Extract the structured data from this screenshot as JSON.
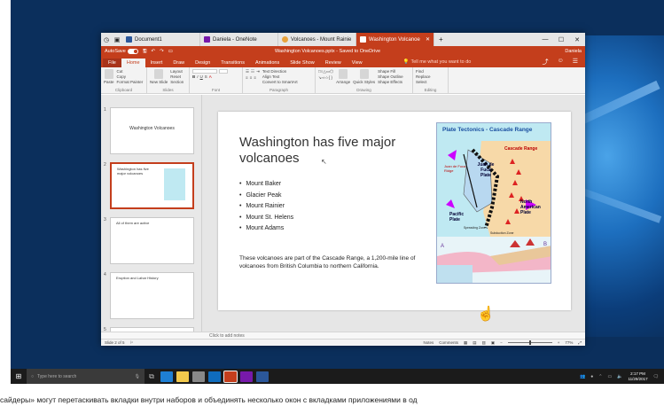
{
  "browser_tabs": [
    {
      "label": "Document1",
      "color": "#2b579a"
    },
    {
      "label": "Daniela - OneNote",
      "color": "#7719aa"
    },
    {
      "label": "Volcanoes - Mount Rainie",
      "color": "#c43e1c"
    },
    {
      "label": "Washington Volcanoe",
      "color": "#c43e1c",
      "active": true
    }
  ],
  "titlebar": {
    "autosave_label": "AutoSave",
    "autosave_state": "On",
    "doc_title": "Washington Volcanoes.pptx - Saved to OneDrive",
    "user": "Daniela"
  },
  "ribbon_tabs": [
    "File",
    "Home",
    "Insert",
    "Draw",
    "Design",
    "Transitions",
    "Animations",
    "Slide Show",
    "Review",
    "View"
  ],
  "active_ribbon_tab": "Home",
  "tell_me": "Tell me what you want to do",
  "ribbon_groups": {
    "clipboard": {
      "label": "Clipboard",
      "paste": "Paste",
      "cut": "Cut",
      "copy": "Copy",
      "format_painter": "Format Painter"
    },
    "slides": {
      "label": "Slides",
      "new_slide": "New Slide",
      "layout": "Layout",
      "reset": "Reset",
      "section": "Section"
    },
    "font": {
      "label": "Font"
    },
    "paragraph": {
      "label": "Paragraph",
      "text_direction": "Text Direction",
      "align_text": "Align Text",
      "convert": "Convert to SmartArt"
    },
    "drawing": {
      "label": "Drawing",
      "arrange": "Arrange",
      "quick_styles": "Quick Styles",
      "shape_fill": "Shape Fill",
      "shape_outline": "Shape Outline",
      "shape_effects": "Shape Effects"
    },
    "editing": {
      "label": "Editing",
      "find": "Find",
      "replace": "Replace",
      "select": "Select"
    }
  },
  "thumbnails": [
    {
      "num": "1",
      "title": "Washington Volcanoes"
    },
    {
      "num": "2",
      "title": "Washington has five major volcanoes"
    },
    {
      "num": "3",
      "title": "All of them are active"
    },
    {
      "num": "4",
      "title": "Eruption and Lahar History"
    },
    {
      "num": "5",
      "title": ""
    }
  ],
  "slide": {
    "title": "Washington has five major volcanoes",
    "bullets": [
      "Mount Baker",
      "Glacier Peak",
      "Mount Rainier",
      "Mount St. Helens",
      "Mount Adams"
    ],
    "paragraph": "These volcanoes are part of the Cascade Range, a 1,200-mile line of volcanoes from British Columbia to northern California.",
    "map": {
      "title": "Plate Tectonics - Cascade Range",
      "labels": [
        "Cascade Range",
        "Juan de Fuca Plate",
        "Juan de Fuca Ridge",
        "Pacific Plate",
        "North American Plate",
        "Spreading Zone",
        "Subduction Zone",
        "A",
        "B"
      ]
    }
  },
  "notes_placeholder": "Click to add notes",
  "status": {
    "slide_info": "Slide 2 of 5",
    "notes": "Notes",
    "comments": "Comments",
    "zoom": "77%"
  },
  "taskbar": {
    "search_placeholder": "Type here to search",
    "time": "2:17 PM",
    "date": "11/29/2017"
  },
  "caption": "сайдеры» могут перетаскивать вкладки внутри наборов и объединять несколько окон с вкладками приложениями в од"
}
